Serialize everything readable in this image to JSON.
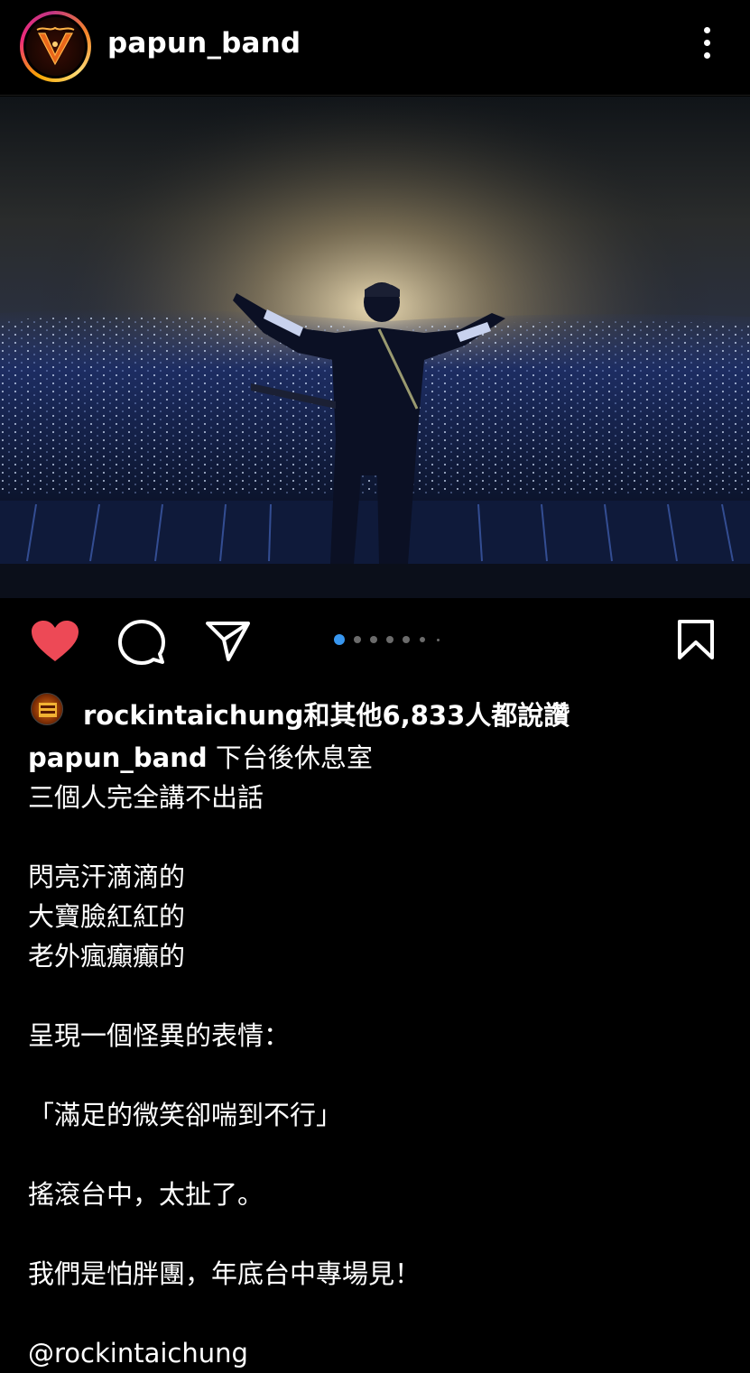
{
  "header": {
    "username": "papun_band",
    "avatar_icon": "band-logo-avatar",
    "more_icon": "more-vertical-icon"
  },
  "post": {
    "image_description_icon": "concert-photo",
    "carousel": {
      "total": 7,
      "active_index": 0
    }
  },
  "actions": {
    "like_icon": "heart-filled-icon",
    "comment_icon": "comment-icon",
    "share_icon": "send-icon",
    "save_icon": "bookmark-icon",
    "liked": true,
    "like_color": "#ed4956"
  },
  "likes": {
    "text": "rockintaichung和其他6,833人都說讚"
  },
  "caption": {
    "username": "papun_band",
    "first_line": "下台後休息室",
    "lines": [
      "三個人完全講不出話",
      "",
      "閃亮汗滴滴的",
      "大寶臉紅紅的",
      "老外瘋癲癲的",
      "",
      "呈現一個怪異的表情：",
      "",
      "「滿足的微笑卻喘到不行」",
      "",
      "搖滾台中，太扯了。",
      "",
      "我們是怕胖團，年底台中專場見！",
      ""
    ],
    "mention": "@rockintaichung"
  }
}
